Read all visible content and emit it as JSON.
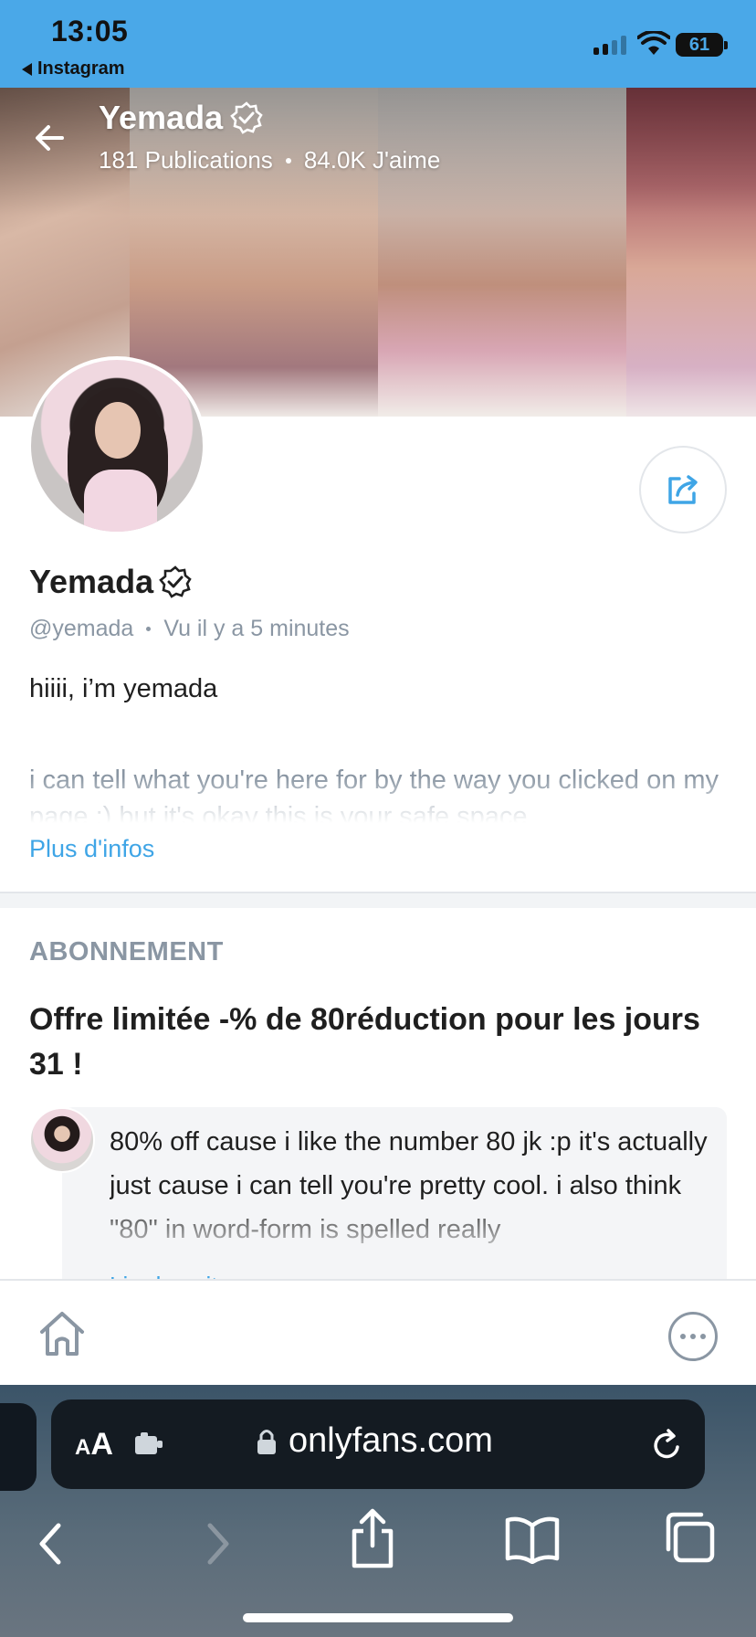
{
  "status_bar": {
    "time": "13:05",
    "back_app": "Instagram",
    "battery": "61"
  },
  "cover": {
    "name": "Yemada",
    "posts": "181 Publications",
    "likes": "84.0K J'aime"
  },
  "profile": {
    "name": "Yemada",
    "handle": "@yemada",
    "last_seen": "Vu  il y a 5 minutes",
    "bio_line1": "hiiii, i’m yemada",
    "bio_line2": "i can tell what you're here for by the way you clicked on my page ;) but it's okay this is your safe space",
    "more_link": "Plus d'infos"
  },
  "subscription": {
    "heading": "ABONNEMENT",
    "offer": "Offre limitée -% de 80réduction pour les jours 31 !",
    "message": "80% off cause i like the number 80 jk :p it's actually just cause i can tell you're pretty cool. i also think \"80\" in word-form is spelled really",
    "message_more": "Lire la suite"
  },
  "browser": {
    "aa_small": "A",
    "aa_big": "A",
    "url": "onlyfans.com"
  },
  "colors": {
    "status_bar": "#4aa8e8",
    "link": "#3fa5e6",
    "muted": "#8a96a3"
  },
  "icons": [
    "back-arrow-icon",
    "verified-badge-icon",
    "share-icon",
    "home-icon",
    "more-icon",
    "lock-icon",
    "reload-icon",
    "extension-icon",
    "chevron-left-icon",
    "chevron-right-icon",
    "share-up-icon",
    "bookmarks-icon",
    "tabs-icon"
  ]
}
